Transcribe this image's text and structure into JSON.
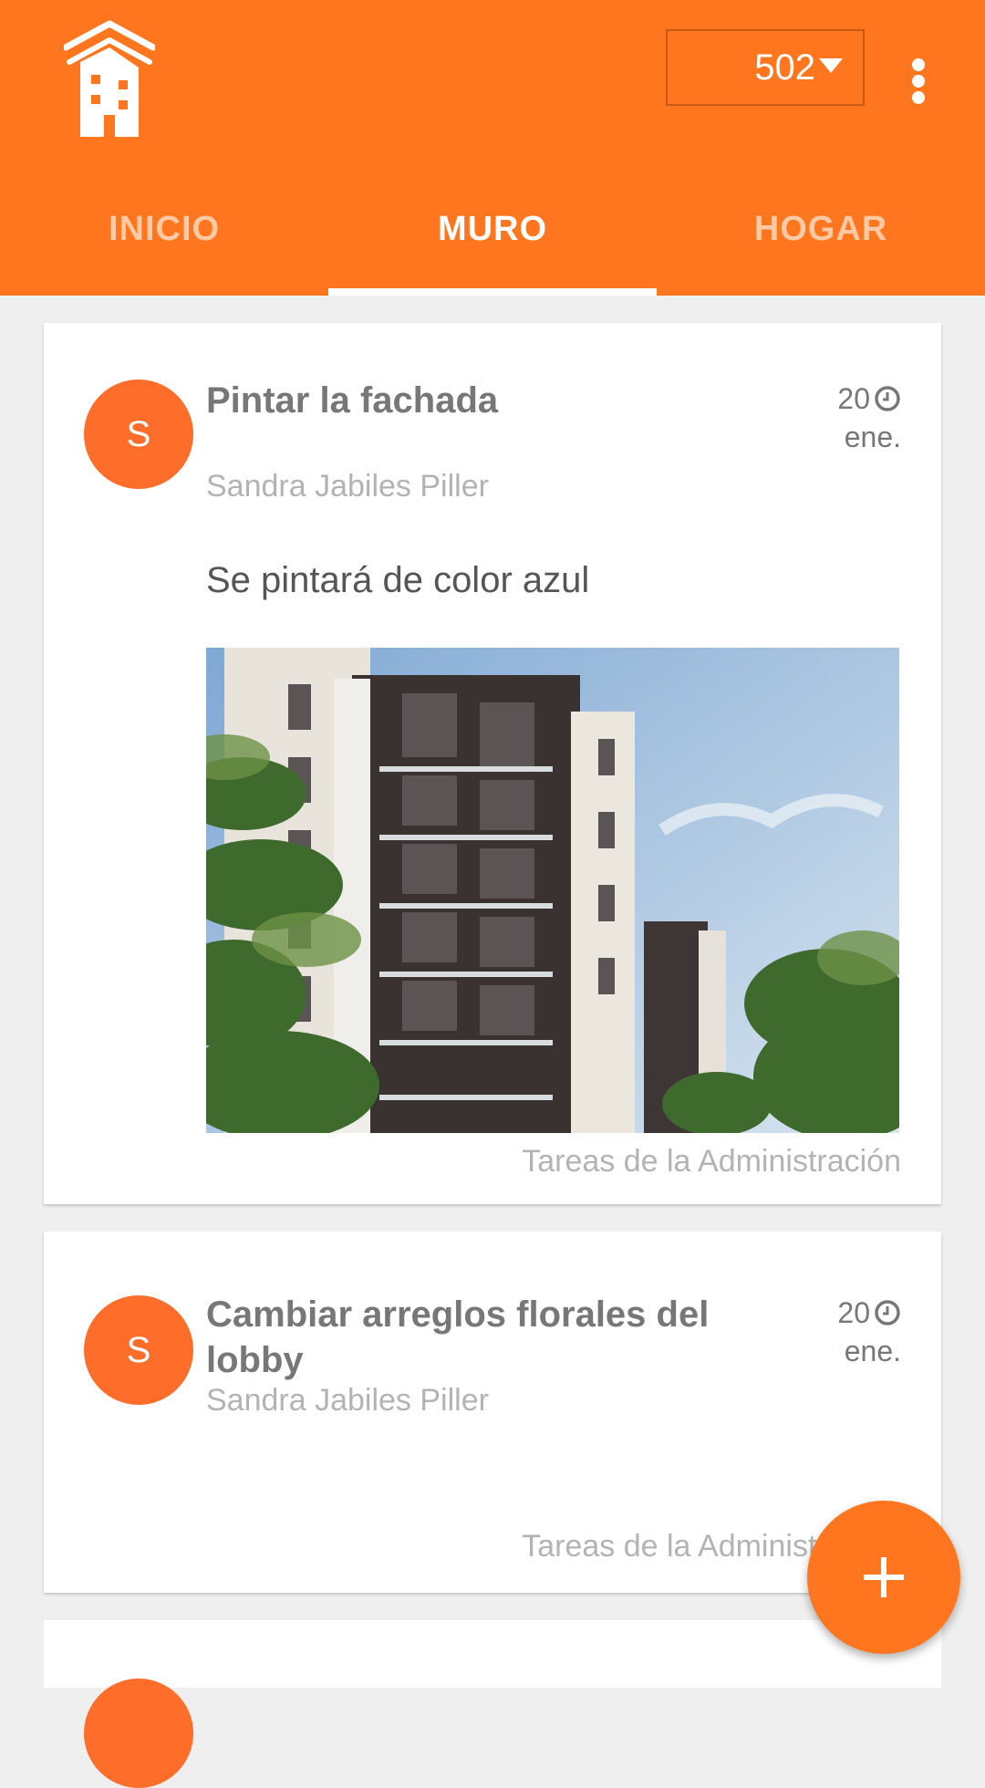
{
  "header": {
    "logo_icon": "building-logo-icon",
    "unit_selector": {
      "value": "502",
      "icon": "dropdown-caret-icon"
    },
    "menu_icon": "more-vert-icon",
    "tabs": [
      {
        "label": "INICIO",
        "active": false
      },
      {
        "label": "MURO",
        "active": true
      },
      {
        "label": "HOGAR",
        "active": false
      }
    ]
  },
  "posts": [
    {
      "avatar_letter": "S",
      "title": "Pintar la fachada",
      "author": "Sandra Jabiles Piller",
      "date_day": "20",
      "date_month": "ene.",
      "body": "Se pintará de color azul",
      "image": "building-photo",
      "category": "Tareas de la Administración"
    },
    {
      "avatar_letter": "S",
      "title": "Cambiar arreglos florales del lobby",
      "author": "Sandra Jabiles Piller",
      "date_day": "20",
      "date_month": "ene.",
      "category": "Tareas de la Administración"
    }
  ],
  "fab": {
    "icon": "plus-icon"
  },
  "colors": {
    "brand": "#ff761e",
    "avatar": "#ff6d2b",
    "background": "#efefef"
  }
}
